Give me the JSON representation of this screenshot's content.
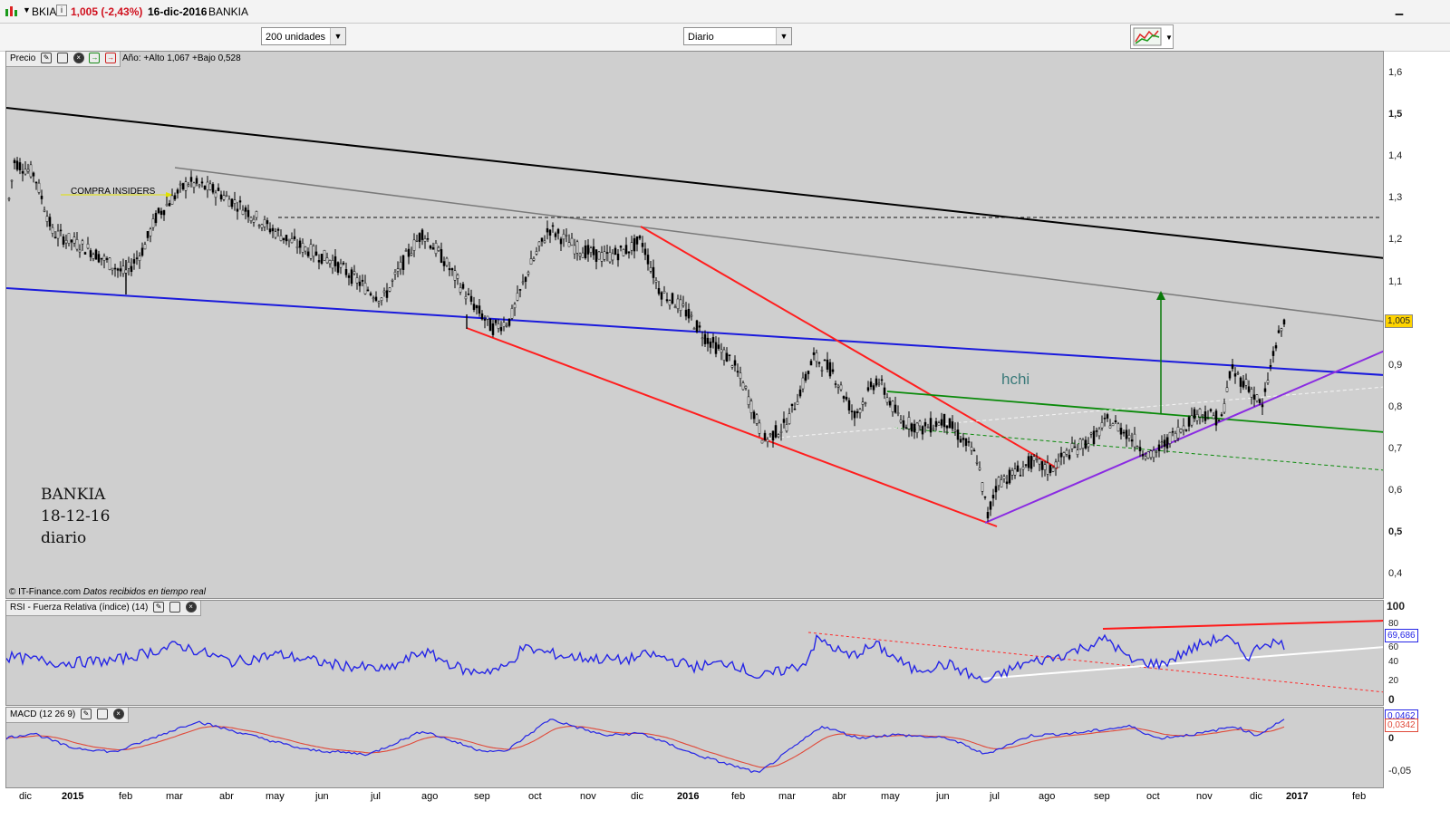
{
  "window": {
    "ticker": "BKIA",
    "price_change": "1,005 (-2,43%)",
    "date": "16-dic-2016",
    "name": "BANKIA"
  },
  "toolbar": {
    "units_select": "200 unidades",
    "period_select": "Diario"
  },
  "price_pane": {
    "label": "Precio",
    "stats": "Año: +Alto 1,067 +Bajo 0,528",
    "current_price_tag": "1,005",
    "y_ticks": [
      "1,6",
      "1,5",
      "1,4",
      "1,3",
      "1,2",
      "1,1",
      "1",
      "0,9",
      "0,8",
      "0,7",
      "0,6",
      "0,5",
      "0,4"
    ],
    "annotation_insiders": "COMPRA  INSIDERS",
    "annotation_hchi": "hchi",
    "note_lines": [
      "BANKIA",
      "18-12-16",
      "diario"
    ],
    "footer_source": "© IT-Finance.com",
    "footer_realtime": "Datos recibidos en tiempo real",
    "colors": {
      "black_line": "#000000",
      "gray_line": "#7a7a7a",
      "blue_line": "#1a1adc",
      "red_line": "#ff1e1e",
      "green_line": "#0a8a0a",
      "purple_line": "#8a2be2",
      "candles": "#000000"
    }
  },
  "rsi_pane": {
    "label": "RSI - Fuerza Relativa (índice) (14)",
    "y_ticks": [
      "100",
      "80",
      "60",
      "40",
      "20",
      "0"
    ],
    "value_tag": "69,686",
    "line_color": "#2525e6"
  },
  "macd_pane": {
    "label": "MACD (12 26 9)",
    "y_ticks": [
      "0",
      "-0,05"
    ],
    "value_tag_1": "0,0462",
    "value_tag_2": "0,0342",
    "macd_color": "#2525e6",
    "signal_color": "#e04a3a"
  },
  "x_axis": {
    "labels": [
      "dic",
      "2015",
      "feb",
      "mar",
      "abr",
      "may",
      "jun",
      "jul",
      "ago",
      "sep",
      "oct",
      "nov",
      "dic",
      "2016",
      "feb",
      "mar",
      "abr",
      "may",
      "jun",
      "jul",
      "ago",
      "sep",
      "oct",
      "nov",
      "dic",
      "2017",
      "feb"
    ],
    "bold": [
      "2015",
      "2016",
      "2017"
    ]
  },
  "chart_data": {
    "type": "line",
    "title": "",
    "series": [
      {
        "name": "",
        "x": [
          "dic-2014",
          "ene-2015",
          "feb-2015",
          "mar-2015",
          "abr-2015",
          "may-2015",
          "jun-2015",
          "jul-2015",
          "ago-2015",
          "sep-2015",
          "oct-2015",
          "nov-2015",
          "dic-2015",
          "ene-2016",
          "feb-2016",
          "mar-2016",
          "abr-2016",
          "may-2016",
          "jun-2016",
          "jul-2016",
          "ago-2016",
          "sep-2016",
          "oct-2016",
          "nov-2016",
          "dic-2016"
        ],
        "values": [
          1.4,
          1.24,
          1.14,
          1.34,
          1.34,
          1.26,
          1.18,
          1.1,
          1.22,
          1.02,
          1.22,
          1.18,
          1.2,
          1.02,
          0.76,
          0.9,
          0.82,
          0.8,
          0.66,
          0.6,
          0.7,
          0.78,
          0.72,
          0.82,
          1.005
        ]
      }
    ],
    "ylim": [
      0.35,
      1.65
    ]
  }
}
